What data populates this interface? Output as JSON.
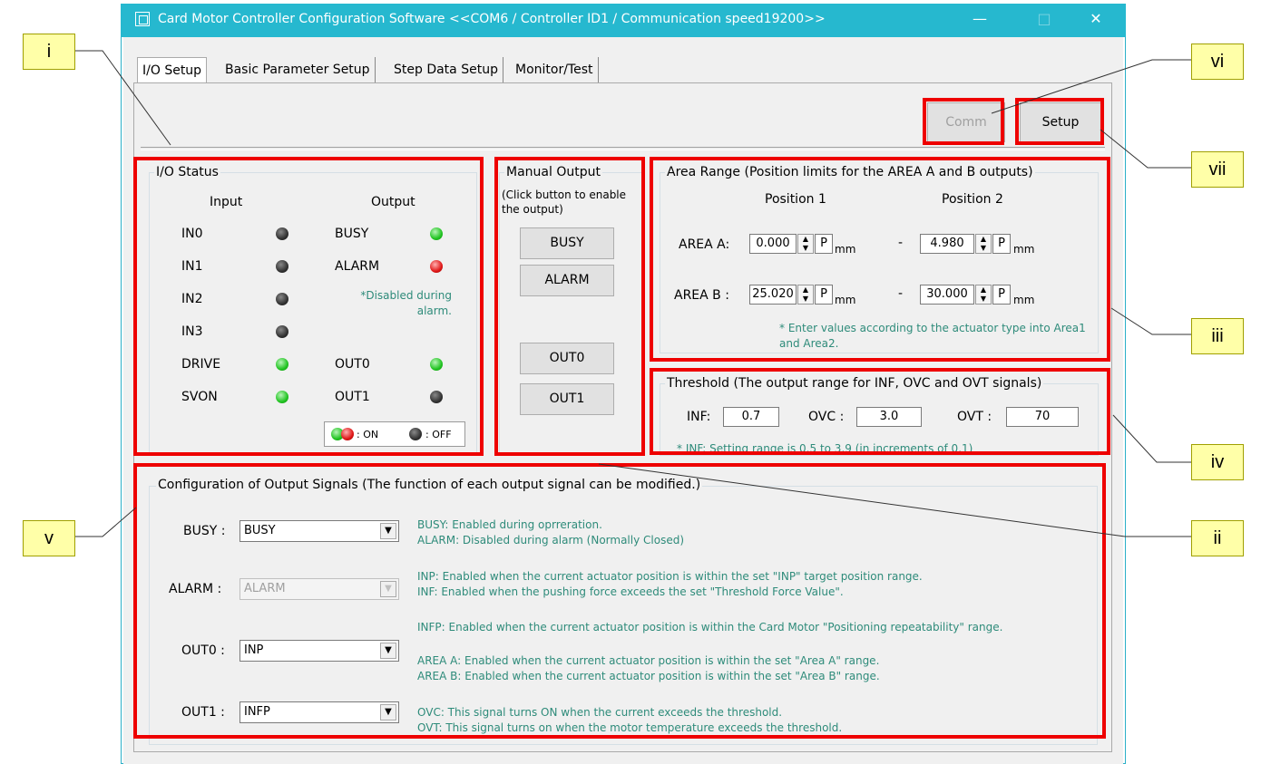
{
  "window": {
    "title": "Card Motor Controller Configuration Software <<COM6 / Controller ID1 / Communication speed19200>>",
    "minimize_icon": "minimize-icon",
    "maximize_icon": "maximize-icon",
    "close_icon": "close-icon"
  },
  "tabs": [
    {
      "label": "I/O Setup"
    },
    {
      "label": "Basic Parameter Setup"
    },
    {
      "label": "Step Data Setup"
    },
    {
      "label": "Monitor/Test"
    }
  ],
  "toolbar": {
    "comm_label": "Comm",
    "setup_label": "Setup"
  },
  "io_status": {
    "title": "I/O Status",
    "input_header": "Input",
    "output_header": "Output",
    "inputs": [
      {
        "label": "IN0",
        "state": "off"
      },
      {
        "label": "IN1",
        "state": "off"
      },
      {
        "label": "IN2",
        "state": "off"
      },
      {
        "label": "IN3",
        "state": "off"
      },
      {
        "label": "DRIVE",
        "state": "on"
      },
      {
        "label": "SVON",
        "state": "on"
      }
    ],
    "outputs": {
      "busy": {
        "label": "BUSY",
        "state": "on"
      },
      "alarm": {
        "label": "ALARM",
        "state": "alarm"
      },
      "out0": {
        "label": "OUT0",
        "state": "on"
      },
      "out1": {
        "label": "OUT1",
        "state": "off"
      }
    },
    "alarm_note": "*Disabled during alarm.",
    "legend_on": ": ON",
    "legend_off": ": OFF"
  },
  "manual_output": {
    "title": "Manual Output",
    "note": "(Click button to enable the output)",
    "buttons": [
      "BUSY",
      "ALARM",
      "OUT0",
      "OUT1"
    ]
  },
  "area_range": {
    "title": "Area Range (Position limits for the AREA A and B outputs)",
    "position1_header": "Position 1",
    "position2_header": "Position 2",
    "area_a_label": "AREA A:",
    "area_b_label": "AREA B :",
    "area_a_pos1": "0.000",
    "area_a_pos2": "4.980",
    "area_b_pos1": "25.020",
    "area_b_pos2": "30.000",
    "p_label": "P",
    "unit": "mm",
    "dash": "-",
    "note": "* Enter values according to the actuator type into Area1 and Area2."
  },
  "threshold": {
    "title": "Threshold (The output range for INF, OVC and OVT signals)",
    "inf_label": "INF:",
    "inf_value": "0.7",
    "ovc_label": "OVC :",
    "ovc_value": "3.0",
    "ovt_label": "OVT :",
    "ovt_value": "70",
    "note": "* INF: Setting range is 0.5 to 3.9 (in increments of 0.1)"
  },
  "output_config": {
    "title": "Configuration of Output Signals (The function of each output signal can be modified.)",
    "rows": [
      {
        "label": "BUSY :",
        "value": "BUSY"
      },
      {
        "label": "ALARM :",
        "value": "ALARM"
      },
      {
        "label": "OUT0 :",
        "value": "INP"
      },
      {
        "label": "OUT1 :",
        "value": "INFP"
      }
    ],
    "descriptions": [
      "BUSY: Enabled during oprreration.",
      "ALARM: Disabled during alarm (Normally Closed)",
      "INP: Enabled when the current actuator position is within the set \"INP\" target position range.",
      "INF: Enabled when the pushing force exceeds the set \"Threshold Force Value\".",
      "INFP: Enabled when the current actuator position is within the Card Motor \"Positioning repeatability\" range.",
      "AREA A: Enabled when the current actuator position is within the set \"Area A\" range.",
      "AREA B: Enabled when the current actuator position is within the set \"Area B\" range.",
      "OVC: This signal turns ON when the current exceeds the threshold.",
      "OVT: This signal turns on when the motor temperature exceeds the threshold."
    ]
  },
  "callouts": {
    "i": "i",
    "ii": "ii",
    "iii": "iii",
    "iv": "iv",
    "v": "v",
    "vi": "vi",
    "vii": "vii"
  },
  "colors": {
    "titlebar": "#26b8cf",
    "highlight": "#ee0000",
    "callout_bg": "#ffffa8",
    "note_text": "#2e8b7a"
  }
}
